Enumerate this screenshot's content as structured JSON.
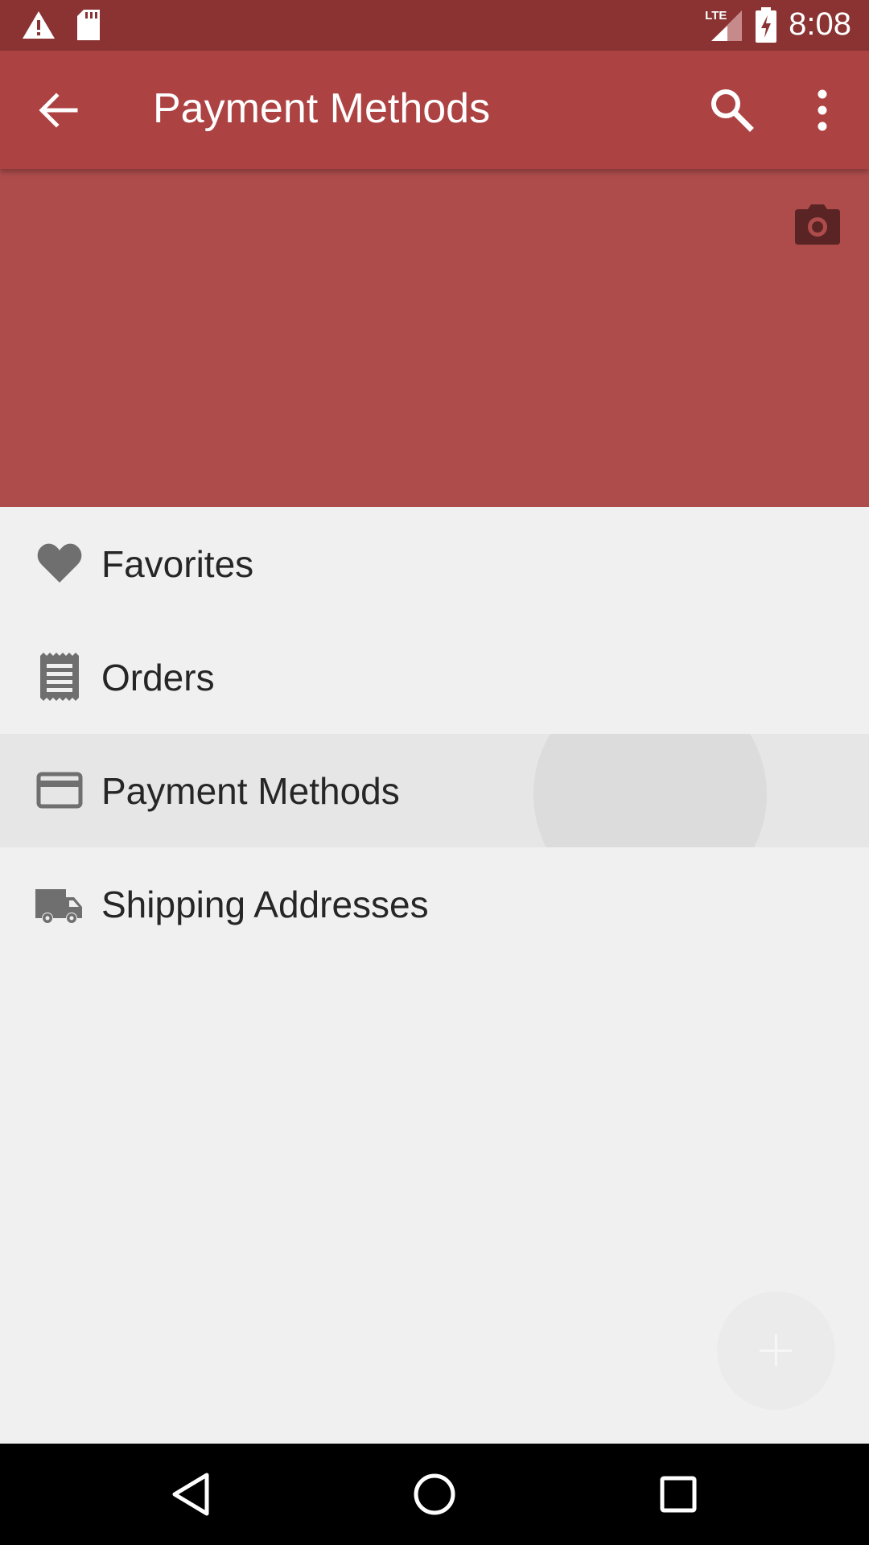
{
  "status_bar": {
    "time": "8:08",
    "network": "LTE",
    "icons": [
      "warning-icon",
      "sd-card-icon",
      "signal-icon",
      "battery-charging-icon"
    ]
  },
  "app_bar": {
    "title": "Payment Methods",
    "back_icon": "arrow-back-icon",
    "search_icon": "search-icon",
    "more_icon": "more-vert-icon"
  },
  "header": {
    "camera_icon": "camera-icon",
    "color": "#ae4c4c"
  },
  "menu": {
    "items": [
      {
        "label": "Favorites",
        "icon": "heart-icon"
      },
      {
        "label": "Orders",
        "icon": "receipt-icon"
      },
      {
        "label": "Payment Methods",
        "icon": "credit-card-icon",
        "selected": true
      },
      {
        "label": "Shipping Addresses",
        "icon": "truck-icon"
      }
    ]
  },
  "fab": {
    "icon": "plus-icon"
  },
  "nav_bar": {
    "icons": [
      "back-triangle-icon",
      "home-circle-icon",
      "recents-square-icon"
    ]
  },
  "colors": {
    "primary_dark": "#8a3332",
    "primary": "#ad4243",
    "header": "#ae4c4c"
  }
}
